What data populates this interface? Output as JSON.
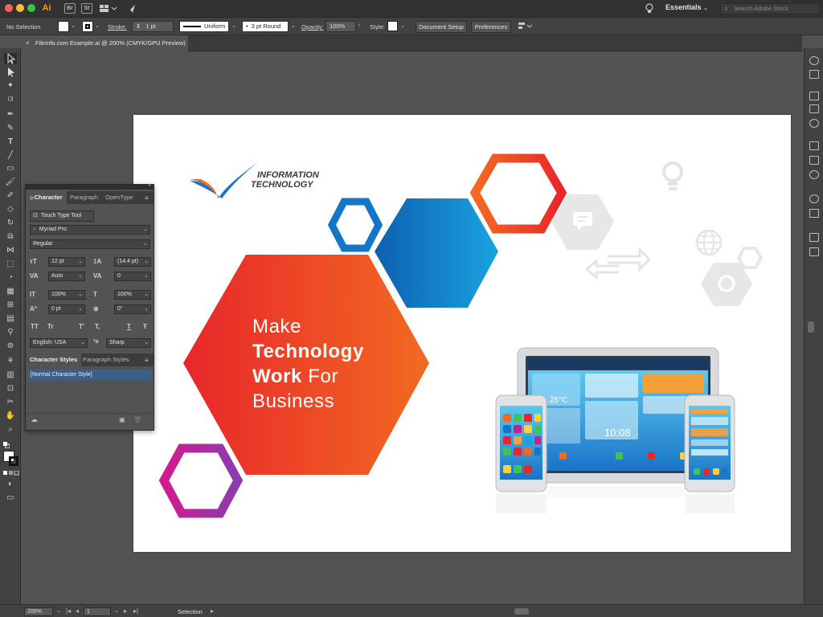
{
  "titlebar": {
    "app_label": "Ai",
    "bridge_label": "Br",
    "stock_label": "St",
    "workspace": "Essentials",
    "search_placeholder": "Search Adobe Stock"
  },
  "controlbar": {
    "selection": "No Selection",
    "stroke_label": "Stroke:",
    "stroke_value": "1 pt",
    "profile": "Uniform",
    "brush": "3 pt Round",
    "opacity_label": "Opacity:",
    "opacity_value": "100%",
    "style_label": "Style:",
    "document_setup": "Document Setup",
    "preferences": "Preferences"
  },
  "document": {
    "tab_title": "FileInfo.com Example.ai @ 200% (CMYK/GPU Preview)"
  },
  "character_panel": {
    "tabs": [
      "Character",
      "Paragraph",
      "OpenType"
    ],
    "touch_type_tool": "Touch Type Tool",
    "font_family": "Myriad Pro",
    "font_style": "Regular",
    "font_size": "12 pt",
    "leading": "(14.4 pt)",
    "kerning": "Auto",
    "tracking": "0",
    "vertical_scale": "100%",
    "horizontal_scale": "100%",
    "baseline_shift": "0 pt",
    "rotation": "0°",
    "language": "English: USA",
    "anti_aliasing": "Sharp",
    "style_tabs": [
      "Character Styles",
      "Paragraph Styles"
    ],
    "style_item": "[Normal Character Style]",
    "text_format_buttons": [
      "TT",
      "Tr",
      "T'",
      "T,",
      "T",
      "Ŧ"
    ]
  },
  "artwork": {
    "logo_line1": "INFORMATION",
    "logo_line2": "TECHNOLOGY",
    "headline_line1": "Make",
    "headline_line2": "Technology",
    "headline_line3_bold": "Work",
    "headline_line3_rest": "For",
    "headline_line4": "Business",
    "weather_temp": "25°C",
    "clock": "10:08"
  },
  "statusbar": {
    "zoom": "200%",
    "artboard": "1",
    "tool_status": "Selection"
  },
  "colors": {
    "accent_orange": "#f0572a",
    "accent_red": "#e8262b",
    "accent_blue": "#1476c6",
    "accent_magenta": "#c4208f",
    "ui_dark": "#323232",
    "ui_mid": "#535353"
  }
}
